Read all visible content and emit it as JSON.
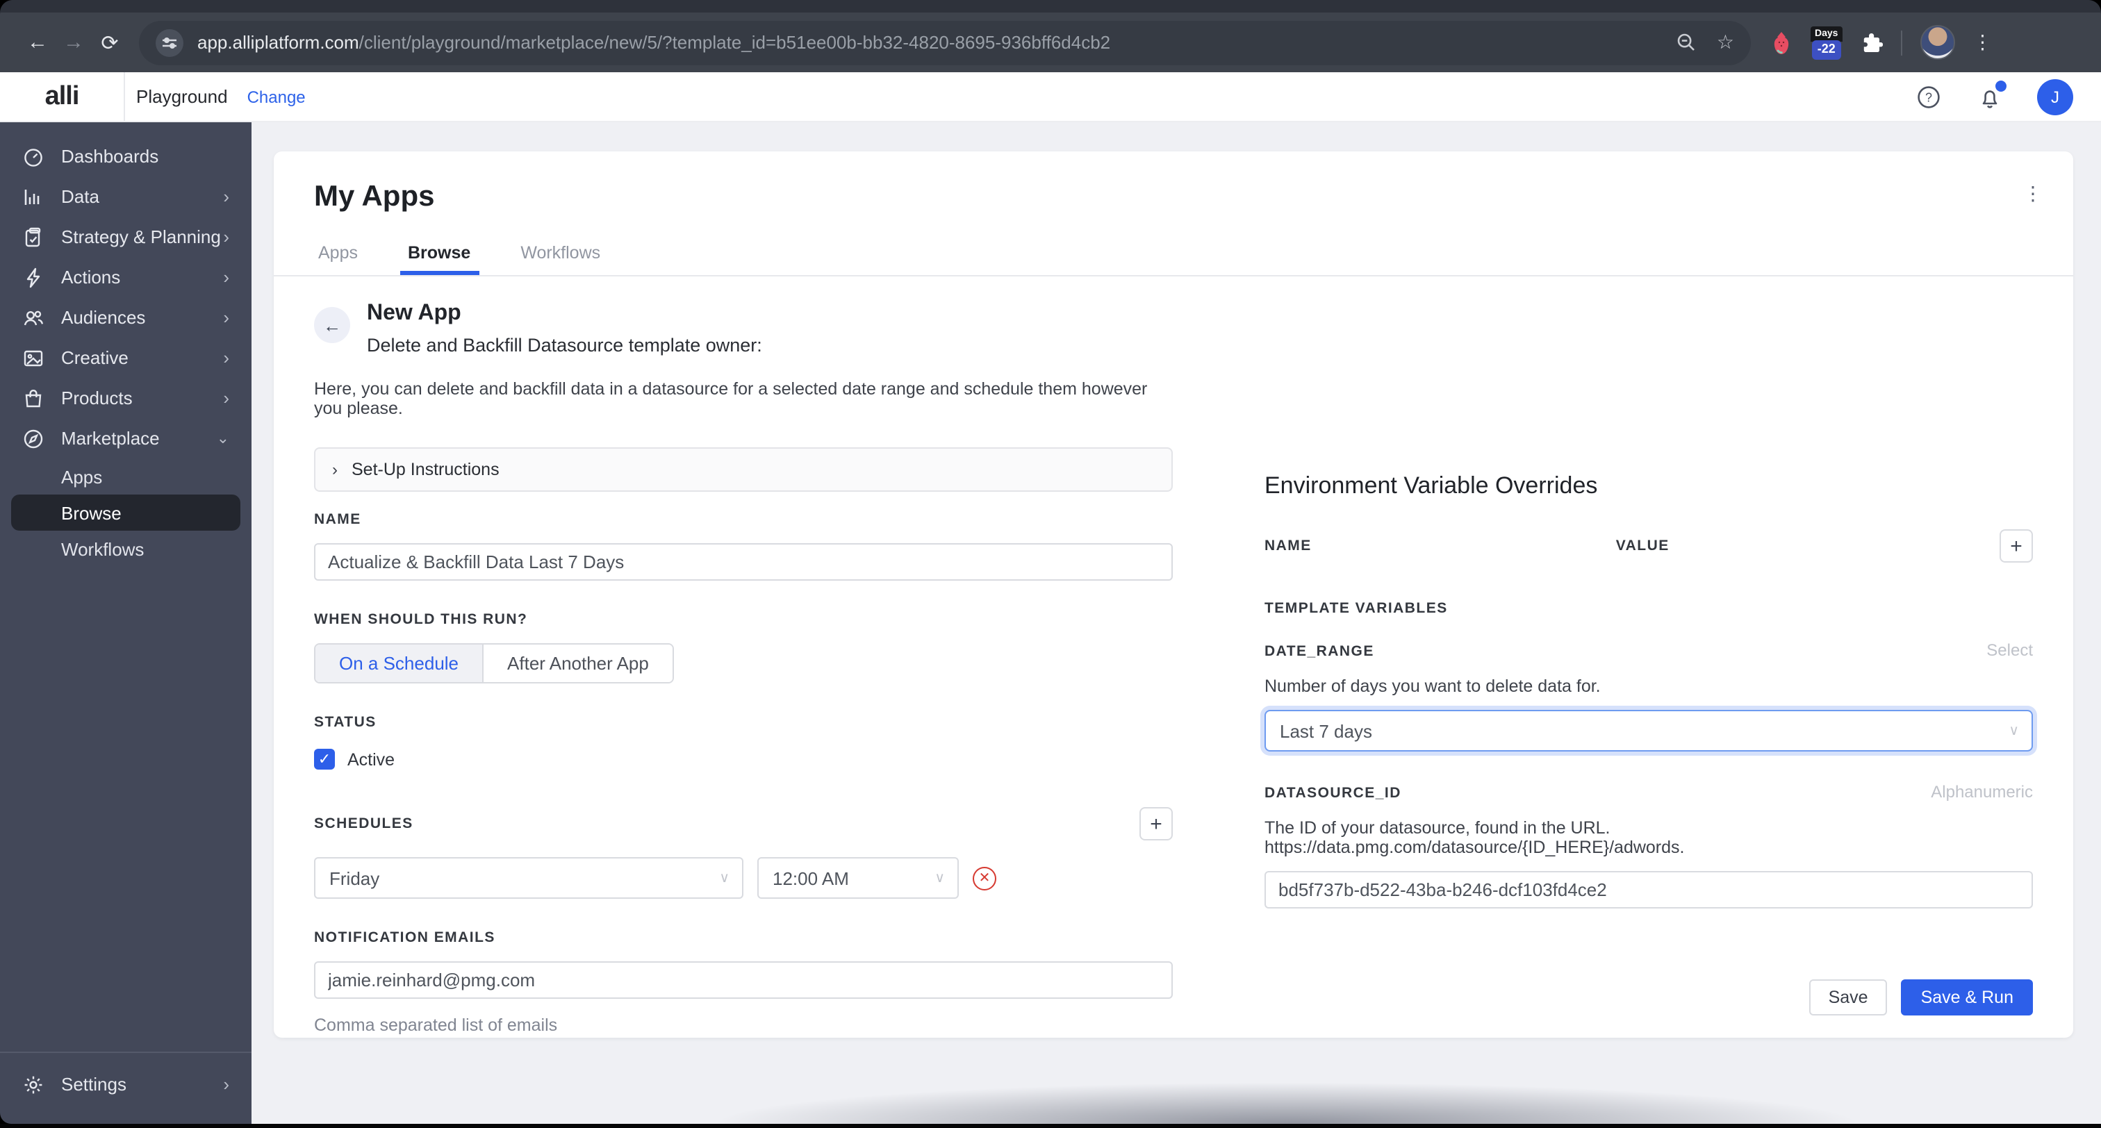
{
  "browser": {
    "url_domain": "app.alliplatform.com",
    "url_path": "/client/playground/marketplace/new/5/?template_id=b51ee00b-bb32-4820-8695-936bff6d4cb2",
    "extension_days_label": "Days",
    "extension_days_value": "-22",
    "icons": [
      "back-icon",
      "forward-icon",
      "reload-icon",
      "site-settings-icon",
      "zoom-out-icon",
      "bookmark-star-icon",
      "strawberry-extension-icon",
      "days-extension-badge",
      "extensions-puzzle-icon",
      "profile-avatar",
      "browser-menu-kebab-icon"
    ]
  },
  "header": {
    "logo": "alli",
    "workspace": "Playground",
    "change_link": "Change",
    "avatar_initial": "J",
    "icons": [
      "help-icon",
      "bell-icon",
      "user-avatar"
    ]
  },
  "sidebar": {
    "items": [
      {
        "label": "Dashboards",
        "icon": "gauge-icon",
        "chevron": ""
      },
      {
        "label": "Data",
        "icon": "bar-chart-icon",
        "chevron": "›"
      },
      {
        "label": "Strategy & Planning",
        "icon": "clipboard-icon",
        "chevron": "›"
      },
      {
        "label": "Actions",
        "icon": "bolt-icon",
        "chevron": "›"
      },
      {
        "label": "Audiences",
        "icon": "users-icon",
        "chevron": "›"
      },
      {
        "label": "Creative",
        "icon": "image-icon",
        "chevron": "›"
      },
      {
        "label": "Products",
        "icon": "bag-icon",
        "chevron": "›"
      },
      {
        "label": "Marketplace",
        "icon": "compass-icon",
        "chevron": "⌄",
        "expanded": true
      }
    ],
    "marketplace_children": [
      {
        "label": "Apps",
        "active": false
      },
      {
        "label": "Browse",
        "active": true
      },
      {
        "label": "Workflows",
        "active": false
      }
    ],
    "settings": {
      "label": "Settings",
      "icon": "gear-icon",
      "chevron": "›"
    }
  },
  "main": {
    "title": "My Apps",
    "tabs": [
      {
        "label": "Apps",
        "active": false
      },
      {
        "label": "Browse",
        "active": true
      },
      {
        "label": "Workflows",
        "active": false
      }
    ],
    "app": {
      "heading": "New App",
      "subtitle": "Delete and Backfill Datasource template owner:",
      "description": "Here, you can delete and backfill data in a datasource for a selected date range and schedule them however you please.",
      "setup_instructions": "Set-Up Instructions"
    },
    "form": {
      "name_label": "NAME",
      "name_value": "Actualize & Backfill Data Last 7 Days",
      "run_label": "WHEN SHOULD THIS RUN?",
      "run_options": [
        {
          "label": "On a Schedule",
          "active": true
        },
        {
          "label": "After Another App",
          "active": false
        }
      ],
      "status_label": "STATUS",
      "status_checkbox_label": "Active",
      "status_checked": true,
      "schedules_label": "SCHEDULES",
      "schedule_day": "Friday",
      "schedule_time": "12:00 AM",
      "emails_label": "NOTIFICATION EMAILS",
      "emails_value": "jamie.reinhard@pmg.com",
      "emails_helper": "Comma separated list of emails"
    },
    "env": {
      "heading": "Environment Variable Overrides",
      "name_col": "NAME",
      "value_col": "VALUE",
      "template_vars_label": "TEMPLATE VARIABLES",
      "date_range_label": "DATE_RANGE",
      "date_range_type": "Select",
      "date_range_desc": "Number of days you want to delete data for.",
      "date_range_value": "Last 7 days",
      "datasource_label": "DATASOURCE_ID",
      "datasource_type": "Alphanumeric",
      "datasource_desc": "The ID of your datasource, found in the URL. https://data.pmg.com/datasource/{ID_HERE}/adwords.",
      "datasource_value": "bd5f737b-d522-43ba-b246-dcf103fd4ce2"
    },
    "actions": {
      "save": "Save",
      "save_run": "Save & Run"
    }
  },
  "colors": {
    "accent_blue": "#2D5FE9",
    "sidebar_bg": "#434859",
    "danger_red": "#D63A31",
    "chrome_bg": "#3E434C"
  }
}
